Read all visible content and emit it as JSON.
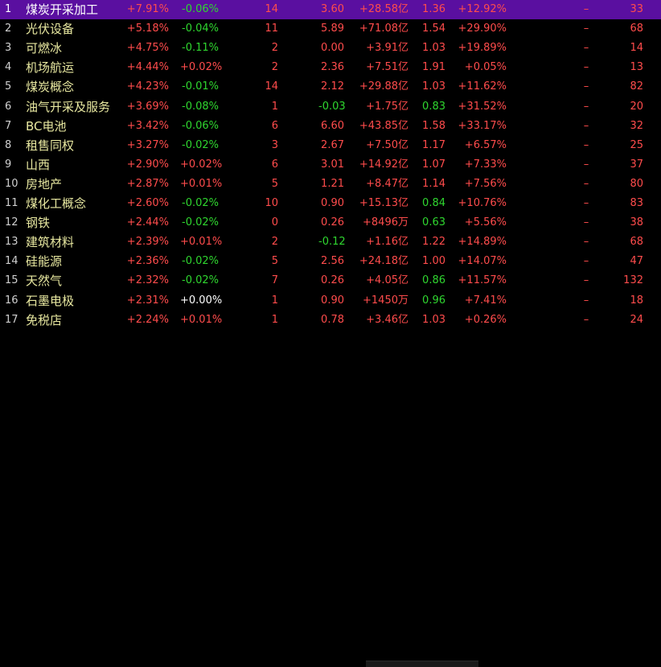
{
  "rows": [
    {
      "idx": "1",
      "name": "煤炭开采加工",
      "chg1": "+7.91%",
      "chg2": "-0.06%",
      "cnt": "14",
      "price": "3.60",
      "amt": "+28.58亿",
      "ratio": "1.36",
      "pct": "+12.92%",
      "dash": "–",
      "last": "33",
      "selected": true
    },
    {
      "idx": "2",
      "name": "光伏设备",
      "chg1": "+5.18%",
      "chg2": "-0.04%",
      "cnt": "11",
      "price": "5.89",
      "amt": "+71.08亿",
      "ratio": "1.54",
      "pct": "+29.90%",
      "dash": "–",
      "last": "68"
    },
    {
      "idx": "3",
      "name": "可燃冰",
      "chg1": "+4.75%",
      "chg2": "-0.11%",
      "cnt": "2",
      "price": "0.00",
      "amt": "+3.91亿",
      "ratio": "1.03",
      "pct": "+19.89%",
      "dash": "–",
      "last": "14"
    },
    {
      "idx": "4",
      "name": "机场航运",
      "chg1": "+4.44%",
      "chg2": "+0.02%",
      "cnt": "2",
      "price": "2.36",
      "amt": "+7.51亿",
      "ratio": "1.91",
      "pct": "+0.05%",
      "dash": "–",
      "last": "13"
    },
    {
      "idx": "5",
      "name": "煤炭概念",
      "chg1": "+4.23%",
      "chg2": "-0.01%",
      "cnt": "14",
      "price": "2.12",
      "amt": "+29.88亿",
      "ratio": "1.03",
      "pct": "+11.62%",
      "dash": "–",
      "last": "82"
    },
    {
      "idx": "6",
      "name": "油气开采及服务",
      "chg1": "+3.69%",
      "chg2": "-0.08%",
      "cnt": "1",
      "price": "-0.03",
      "amt": "+1.75亿",
      "ratio": "0.83",
      "pct": "+31.52%",
      "dash": "–",
      "last": "20"
    },
    {
      "idx": "7",
      "name": "BC电池",
      "chg1": "+3.42%",
      "chg2": "-0.06%",
      "cnt": "6",
      "price": "6.60",
      "amt": "+43.85亿",
      "ratio": "1.58",
      "pct": "+33.17%",
      "dash": "–",
      "last": "32"
    },
    {
      "idx": "8",
      "name": "租售同权",
      "chg1": "+3.27%",
      "chg2": "-0.02%",
      "cnt": "3",
      "price": "2.67",
      "amt": "+7.50亿",
      "ratio": "1.17",
      "pct": "+6.57%",
      "dash": "–",
      "last": "25"
    },
    {
      "idx": "9",
      "name": "山西",
      "chg1": "+2.90%",
      "chg2": "+0.02%",
      "cnt": "6",
      "price": "3.01",
      "amt": "+14.92亿",
      "ratio": "1.07",
      "pct": "+7.33%",
      "dash": "–",
      "last": "37"
    },
    {
      "idx": "10",
      "name": "房地产",
      "chg1": "+2.87%",
      "chg2": "+0.01%",
      "cnt": "5",
      "price": "1.21",
      "amt": "+8.47亿",
      "ratio": "1.14",
      "pct": "+7.56%",
      "dash": "–",
      "last": "80"
    },
    {
      "idx": "11",
      "name": "煤化工概念",
      "chg1": "+2.60%",
      "chg2": "-0.02%",
      "cnt": "10",
      "price": "0.90",
      "amt": "+15.13亿",
      "ratio": "0.84",
      "pct": "+10.76%",
      "dash": "–",
      "last": "83"
    },
    {
      "idx": "12",
      "name": "钢铁",
      "chg1": "+2.44%",
      "chg2": "-0.02%",
      "cnt": "0",
      "price": "0.26",
      "amt": "+8496万",
      "ratio": "0.63",
      "pct": "+5.56%",
      "dash": "–",
      "last": "38"
    },
    {
      "idx": "13",
      "name": "建筑材料",
      "chg1": "+2.39%",
      "chg2": "+0.01%",
      "cnt": "2",
      "price": "-0.12",
      "amt": "+1.16亿",
      "ratio": "1.22",
      "pct": "+14.89%",
      "dash": "–",
      "last": "68"
    },
    {
      "idx": "14",
      "name": "硅能源",
      "chg1": "+2.36%",
      "chg2": "-0.02%",
      "cnt": "5",
      "price": "2.56",
      "amt": "+24.18亿",
      "ratio": "1.00",
      "pct": "+14.07%",
      "dash": "–",
      "last": "47"
    },
    {
      "idx": "15",
      "name": "天然气",
      "chg1": "+2.32%",
      "chg2": "-0.02%",
      "cnt": "7",
      "price": "0.26",
      "amt": "+4.05亿",
      "ratio": "0.86",
      "pct": "+11.57%",
      "dash": "–",
      "last": "132"
    },
    {
      "idx": "16",
      "name": "石墨电极",
      "chg1": "+2.31%",
      "chg2": "+0.00%",
      "cnt": "1",
      "price": "0.90",
      "amt": "+1450万",
      "ratio": "0.96",
      "pct": "+7.41%",
      "dash": "–",
      "last": "18"
    },
    {
      "idx": "17",
      "name": "免税店",
      "chg1": "+2.24%",
      "chg2": "+0.01%",
      "cnt": "1",
      "price": "0.78",
      "amt": "+3.46亿",
      "ratio": "1.03",
      "pct": "+0.26%",
      "dash": "–",
      "last": "24"
    }
  ],
  "colors": {
    "up": "#ff4c4c",
    "down": "#2fd62f",
    "flat": "#ffffff",
    "selected_bg": "#5a0fa0"
  }
}
